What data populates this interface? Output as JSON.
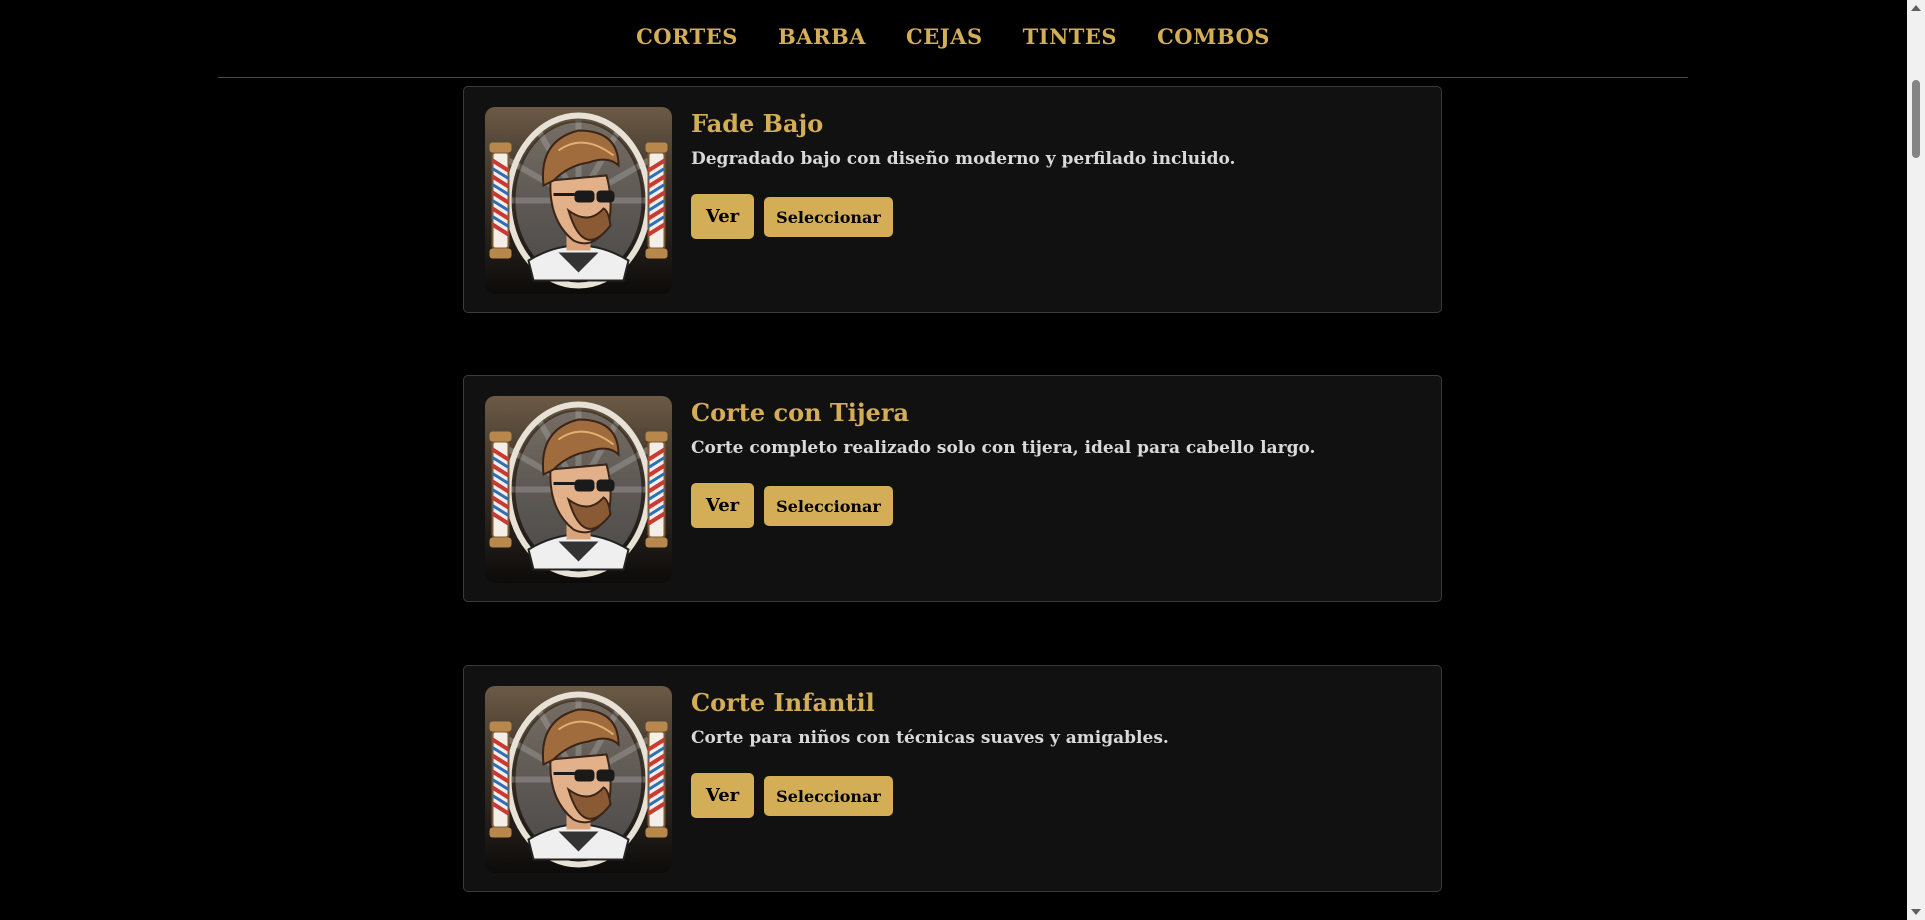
{
  "nav": {
    "items": [
      {
        "label": "CORTES"
      },
      {
        "label": "BARBA"
      },
      {
        "label": "CEJAS"
      },
      {
        "label": "TINTES"
      },
      {
        "label": "COMBOS"
      }
    ]
  },
  "services": [
    {
      "title": "Fade Bajo",
      "description": "Degradado bajo con diseño moderno y perfilado incluido.",
      "view_label": "Ver",
      "select_label": "Seleccionar",
      "image": "barber-logo-image"
    },
    {
      "title": "Corte con Tijera",
      "description": "Corte completo realizado solo con tijera, ideal para cabello largo.",
      "view_label": "Ver",
      "select_label": "Seleccionar",
      "image": "barber-logo-image"
    },
    {
      "title": "Corte Infantil",
      "description": "Corte para niños con técnicas suaves y amigables.",
      "view_label": "Ver",
      "select_label": "Seleccionar",
      "image": "barber-logo-image"
    }
  ],
  "colors": {
    "accent": "#d4ae57",
    "background": "#000000",
    "card": "#111111"
  }
}
